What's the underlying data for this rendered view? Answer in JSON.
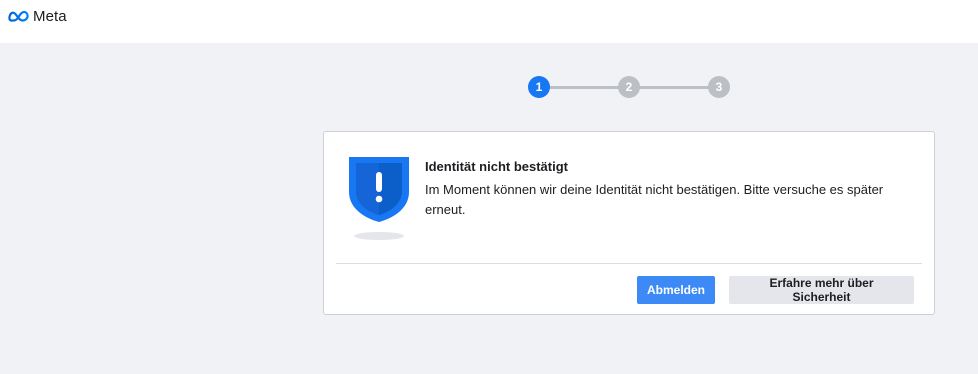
{
  "header": {
    "logo_text": "Meta",
    "logo_icon": "meta-infinity-icon"
  },
  "stepper": {
    "steps": [
      "1",
      "2",
      "3"
    ],
    "active_index": 0
  },
  "card": {
    "icon": "shield-alert-icon",
    "title": "Identität nicht bestätigt",
    "message": "Im Moment können wir deine Identität nicht bestätigen. Bitte versuche es später erneut.",
    "primary_button": "Abmelden",
    "secondary_button": "Erfahre mehr über Sicherheit"
  },
  "colors": {
    "accent": "#1877f2",
    "primary_button": "#3d8af7",
    "step_inactive": "#bcc0c4",
    "background": "#f0f2f5"
  }
}
